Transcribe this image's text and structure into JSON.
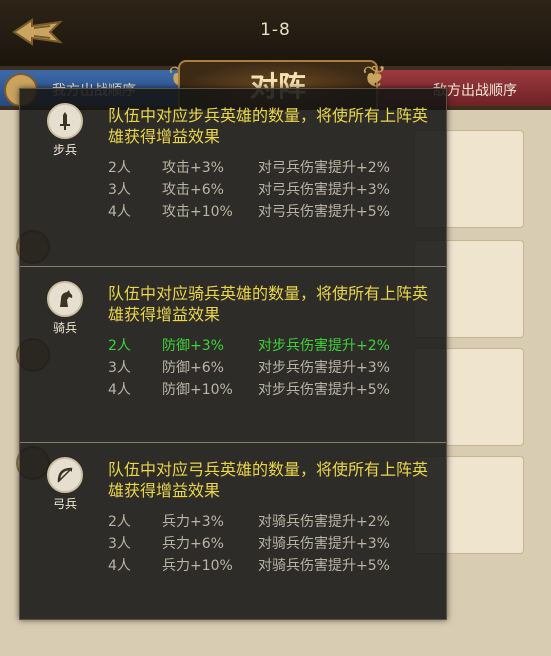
{
  "header": {
    "stage": "1-8"
  },
  "tabs": {
    "left_label": "我方出战顺序",
    "center_title": "对阵",
    "right_label": "敌方出战顺序"
  },
  "tooltip": {
    "sections": [
      {
        "badge": "步兵",
        "icon": "sword-icon",
        "description": "队伍中对应步兵英雄的数量，将使所有上阵英雄获得增益效果",
        "rows": [
          {
            "count": "2人",
            "stat": "攻击+3%",
            "bonus": "对弓兵伤害提升+2%",
            "active": false
          },
          {
            "count": "3人",
            "stat": "攻击+6%",
            "bonus": "对弓兵伤害提升+3%",
            "active": false
          },
          {
            "count": "4人",
            "stat": "攻击+10%",
            "bonus": "对弓兵伤害提升+5%",
            "active": false
          }
        ]
      },
      {
        "badge": "骑兵",
        "icon": "horse-icon",
        "description": "队伍中对应骑兵英雄的数量，将使所有上阵英雄获得增益效果",
        "rows": [
          {
            "count": "2人",
            "stat": "防御+3%",
            "bonus": "对步兵伤害提升+2%",
            "active": true
          },
          {
            "count": "3人",
            "stat": "防御+6%",
            "bonus": "对步兵伤害提升+3%",
            "active": false
          },
          {
            "count": "4人",
            "stat": "防御+10%",
            "bonus": "对步兵伤害提升+5%",
            "active": false
          }
        ]
      },
      {
        "badge": "弓兵",
        "icon": "bow-icon",
        "description": "队伍中对应弓兵英雄的数量，将使所有上阵英雄获得增益效果",
        "rows": [
          {
            "count": "2人",
            "stat": "兵力+3%",
            "bonus": "对骑兵伤害提升+2%",
            "active": false
          },
          {
            "count": "3人",
            "stat": "兵力+6%",
            "bonus": "对骑兵伤害提升+3%",
            "active": false
          },
          {
            "count": "4人",
            "stat": "兵力+10%",
            "bonus": "对骑兵伤害提升+5%",
            "active": false
          }
        ]
      }
    ]
  },
  "colors": {
    "description": "#ebd64b",
    "row_default": "#bab4a6",
    "row_active": "#3fd23a"
  }
}
